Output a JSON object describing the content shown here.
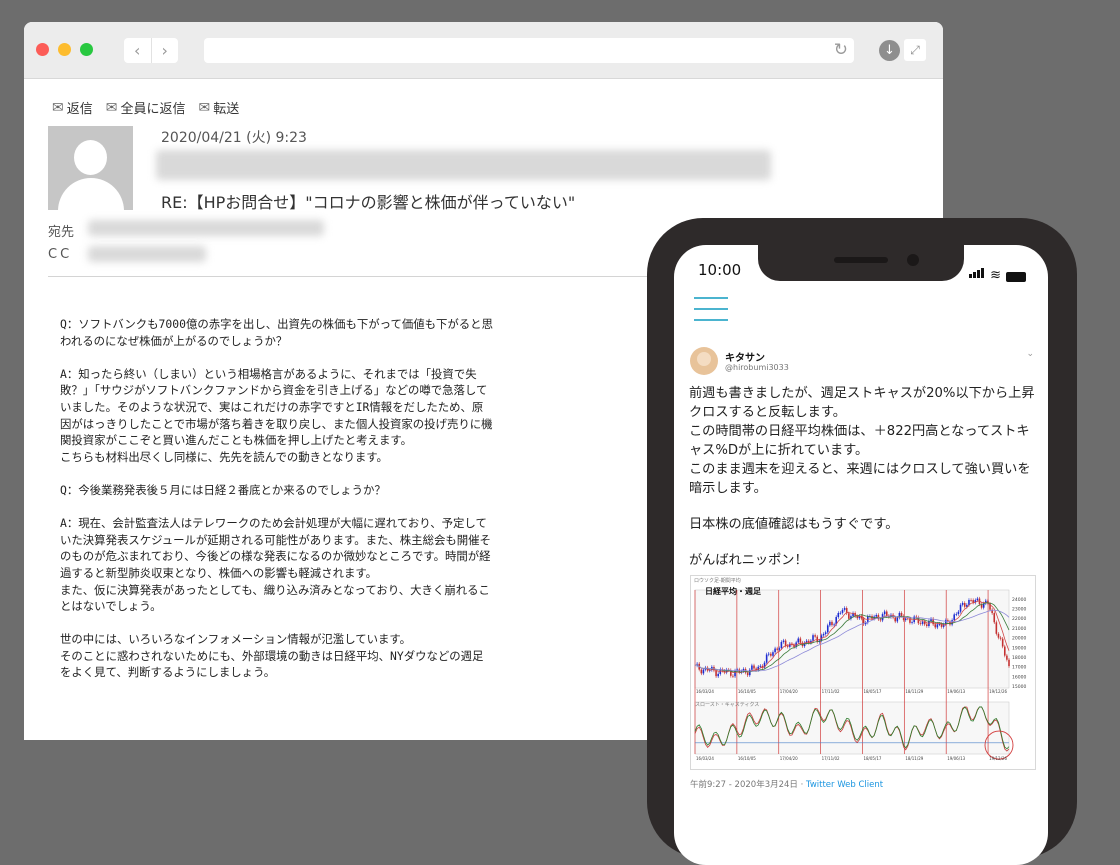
{
  "browser": {
    "back_glyph": "‹",
    "forward_glyph": "›",
    "reload_glyph": "↻",
    "download_glyph": "↓",
    "fullscreen_glyph": "⤢"
  },
  "mail": {
    "actions": [
      {
        "icon": "reply-icon",
        "label": "返信"
      },
      {
        "icon": "reply-all-icon",
        "label": "全員に返信"
      },
      {
        "icon": "forward-icon",
        "label": "転送"
      }
    ],
    "date": "2020/04/21 (火) 9:23",
    "subject": "RE:【HPお問合せ】\"コロナの影響と株価が伴っていない\"",
    "to_label": "宛先",
    "cc_label": "CC",
    "body": [
      "Q：ソフトバンクも7000億の赤字を出し、出資先の株価も下がって価値も下がると思\nわれるのになぜ株価が上がるのでしょうか？",
      "A：知ったら終い（しまい）という相場格言があるように、それまでは「投資で失\n敗？」「サウジがソフトバンクファンドから資金を引き上げる」などの噂で急落して\nいました。そのような状況で、実はこれだけの赤字ですとIR情報をだしたため、原\n因がはっきりしたことで市場が落ち着きを取り戻し、また個人投資家の投げ売りに機\n関投資家がここぞと買い進んだことも株価を押し上げたと考えます。\nこちらも材料出尽くし同様に、先先を読んでの動きとなります。",
      "Q：今後業務発表後５月には日経２番底とか来るのでしょうか？",
      "A：現在、会計監査法人はテレワークのため会計処理が大幅に遅れており、予定して\nいた決算発表スケジュールが延期される可能性があります。また、株主総会も開催そ\nのものが危ぶまれており、今後どの様な発表になるのか微妙なところです。時間が経\n過すると新型肺炎収束となり、株価への影響も軽減されます。\nまた、仮に決算発表があったとしても、織り込み済みとなっており、大きく崩れるこ\nとはないでしょう。",
      "世の中には、いろいろなインフォメーション情報が氾濫しています。\nそのことに惑わされないためにも、外部環境の動きは日経平均、NYダウなどの週足\nをよく見て、判断するようにしましょう。"
    ]
  },
  "phone": {
    "time": "10:00",
    "wifi_glyph": "≋",
    "tweet": {
      "name": "キタサン",
      "handle": "@hirobumi3033",
      "chevron": "⌄",
      "paragraphs": [
        "前週も書きましたが、週足ストキャスが20%以下から上昇クロスすると反転します。\nこの時間帯の日経平均株価は、＋822円高となってストキャス%Dが上に折れています。\nこのまま週末を迎えると、来週にはクロスして強い買いを暗示します。",
        "日本株の底値確認はもうすぐです。",
        "がんばれニッポン！"
      ],
      "footer_time": "午前9:27 - 2020年3月24日 · ",
      "footer_source": "Twitter Web Client"
    }
  },
  "chart_data": {
    "type": "line",
    "title": "日経平均・週足",
    "caption": "ロウソク足-期間平均",
    "stoch_caption": "スロースト・キャスティクス",
    "x": [
      "16/03/24",
      "16/06/30",
      "16/10/05",
      "17/01/12",
      "17/04/20",
      "17/07/27",
      "17/11/02",
      "18/02/08",
      "18/05/17",
      "18/08/23",
      "18/11/29",
      "19/03/07",
      "19/06/13",
      "19/09/19",
      "19/12/26",
      "20/03/24"
    ],
    "y_ticks": [
      "24000",
      "23000",
      "22000",
      "21000",
      "20000",
      "19000",
      "18000",
      "17000",
      "16000",
      "15000"
    ],
    "price": [
      16900,
      16500,
      16400,
      16800,
      19200,
      19400,
      20000,
      22800,
      21800,
      22300,
      22000,
      21500,
      21300,
      23800,
      23500,
      16900
    ],
    "stoch_k": [
      40,
      20,
      50,
      80,
      70,
      40,
      90,
      60,
      30,
      70,
      20,
      60,
      40,
      90,
      80,
      10
    ],
    "stoch_d": [
      45,
      25,
      45,
      75,
      72,
      45,
      85,
      65,
      35,
      65,
      25,
      55,
      45,
      85,
      82,
      15
    ],
    "ylim": [
      15000,
      24500
    ],
    "colors": {
      "up": "#1d2bd1",
      "down": "#c43030",
      "ma1": "#d24646",
      "ma2": "#3c7c3c",
      "ma3": "#8d8ad8",
      "vline": "#d23c3c",
      "stoch_k": "#c73b3b",
      "stoch_d": "#2c7c2c"
    }
  }
}
